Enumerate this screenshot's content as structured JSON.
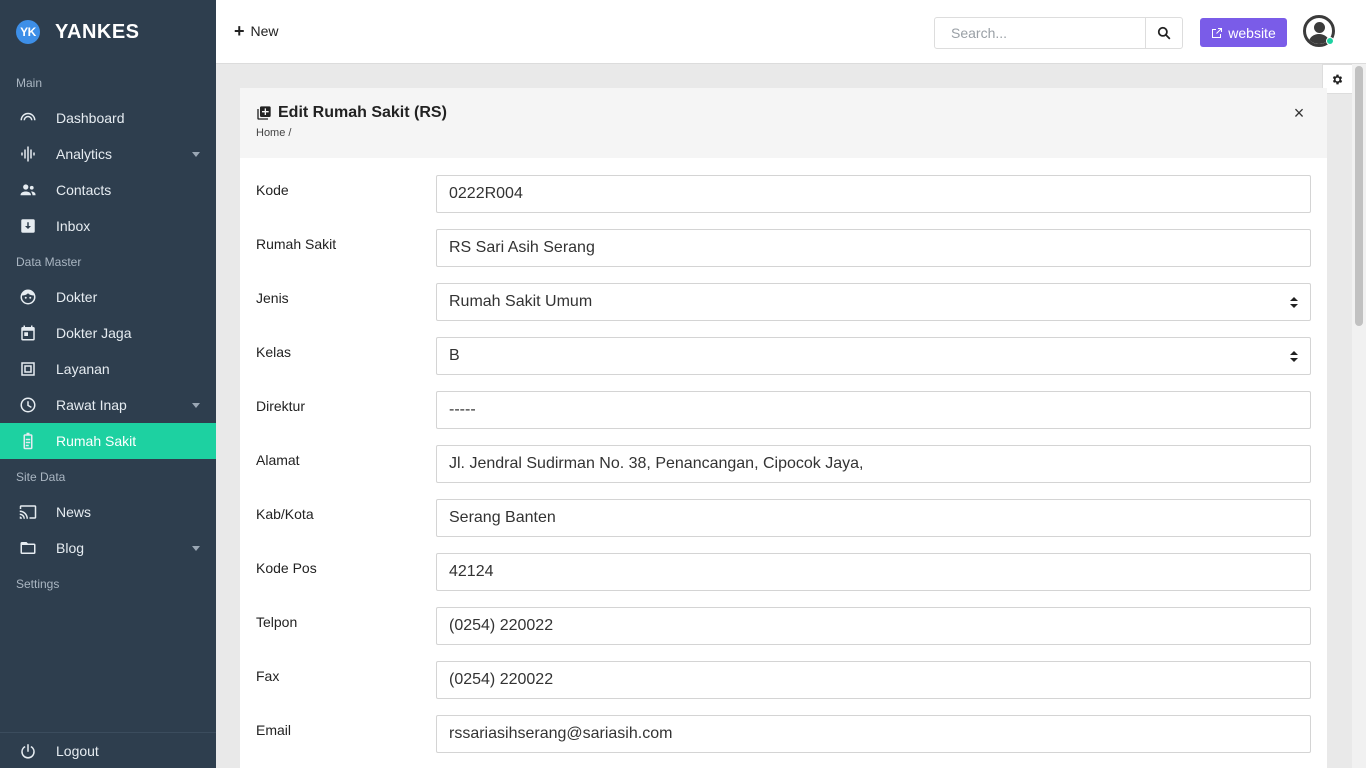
{
  "brand": {
    "logo": "YK",
    "name": "YANKES"
  },
  "sidebar": {
    "sections": [
      {
        "label": "Main",
        "items": [
          {
            "label": "Dashboard",
            "icon": "gauge-icon",
            "dropdown": false
          },
          {
            "label": "Analytics",
            "icon": "analytics-icon",
            "dropdown": true
          },
          {
            "label": "Contacts",
            "icon": "contacts-icon",
            "dropdown": false
          },
          {
            "label": "Inbox",
            "icon": "inbox-icon",
            "dropdown": false
          }
        ]
      },
      {
        "label": "Data Master",
        "items": [
          {
            "label": "Dokter",
            "icon": "doctor-icon",
            "dropdown": false
          },
          {
            "label": "Dokter Jaga",
            "icon": "calendar-icon",
            "dropdown": false
          },
          {
            "label": "Layanan",
            "icon": "service-icon",
            "dropdown": false
          },
          {
            "label": "Rawat Inap",
            "icon": "clock-icon",
            "dropdown": true
          },
          {
            "label": "Rumah Sakit",
            "icon": "hospital-icon",
            "dropdown": false,
            "active": true
          }
        ]
      },
      {
        "label": "Site Data",
        "items": [
          {
            "label": "News",
            "icon": "cast-icon",
            "dropdown": false
          },
          {
            "label": "Blog",
            "icon": "folder-icon",
            "dropdown": true
          }
        ]
      },
      {
        "label": "Settings",
        "items": []
      }
    ],
    "logout_label": "Logout"
  },
  "topbar": {
    "new_label": "New",
    "search_placeholder": "Search...",
    "website_label": "website"
  },
  "page": {
    "title": "Edit Rumah Sakit (RS)",
    "breadcrumb": "Home /"
  },
  "form": {
    "fields": [
      {
        "label": "Kode",
        "value": "0222R004",
        "type": "text"
      },
      {
        "label": "Rumah Sakit",
        "value": "RS Sari Asih Serang",
        "type": "text"
      },
      {
        "label": "Jenis",
        "value": "Rumah Sakit Umum",
        "type": "select"
      },
      {
        "label": "Kelas",
        "value": "B",
        "type": "select"
      },
      {
        "label": "Direktur",
        "value": "-----",
        "type": "text"
      },
      {
        "label": "Alamat",
        "value": "Jl. Jendral Sudirman No. 38, Penancangan, Cipocok Jaya,",
        "type": "text"
      },
      {
        "label": "Kab/Kota",
        "value": "Serang Banten",
        "type": "text"
      },
      {
        "label": "Kode Pos",
        "value": "42124",
        "type": "text"
      },
      {
        "label": "Telpon",
        "value": "(0254) 220022",
        "type": "text"
      },
      {
        "label": "Fax",
        "value": "(0254) 220022",
        "type": "text"
      },
      {
        "label": "Email",
        "value": "rssariasihserang@sariasih.com",
        "type": "text"
      }
    ]
  },
  "colors": {
    "sidebar_bg": "#2e3e4e",
    "active_item": "#1dd1a1",
    "website_button": "#7a5ce8",
    "brand_logo": "#3d8fe8"
  }
}
